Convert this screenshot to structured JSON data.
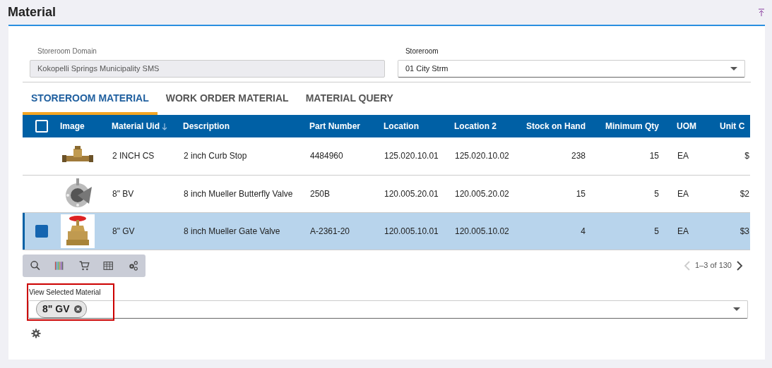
{
  "page_title": "Material",
  "fields": [
    {
      "label": "Storeroom Domain",
      "value": "Kokopelli Springs Municipality SMS",
      "disabled": true,
      "kind": "text"
    },
    {
      "label": "Storeroom",
      "value": "01 City Strm",
      "disabled": false,
      "kind": "select"
    }
  ],
  "tabs": [
    {
      "label": "STOREROOM MATERIAL",
      "selected": true
    },
    {
      "label": "WORK ORDER MATERIAL",
      "selected": false
    },
    {
      "label": "MATERIAL QUERY",
      "selected": false
    }
  ],
  "table": {
    "select_all_checked": false,
    "image_column": "Image",
    "columns": [
      {
        "label": "Material Uid",
        "sorted": true
      },
      {
        "label": "Description",
        "sorted": false
      },
      {
        "label": "Part Number",
        "sorted": false
      },
      {
        "label": "Location",
        "sorted": false
      },
      {
        "label": "Location 2",
        "sorted": false
      },
      {
        "label": "Stock on Hand",
        "sorted": false
      },
      {
        "label": "Minimum Qty",
        "sorted": false
      },
      {
        "label": "UOM",
        "sorted": false
      },
      {
        "label": "Unit C",
        "sorted": false
      }
    ],
    "rows": [
      {
        "selected": false,
        "cells": [
          "2 INCH CS",
          "2 inch Curb Stop",
          "4484960",
          "125.020.10.01",
          "125.020.10.02",
          "238",
          "15",
          "EA",
          "$"
        ]
      },
      {
        "selected": false,
        "cells": [
          "8\" BV",
          "8 inch Mueller Butterfly Valve",
          "250B",
          "120.005.20.01",
          "120.005.20.02",
          "15",
          "5",
          "EA",
          "$2"
        ]
      },
      {
        "selected": true,
        "cells": [
          "8\" GV",
          "8 inch Mueller Gate Valve",
          "A-2361-20",
          "120.005.10.01",
          "120.005.10.02",
          "4",
          "5",
          "EA",
          "$3"
        ]
      }
    ]
  },
  "pager": {
    "text": "1–3 of 130",
    "prev_disabled": true,
    "next_disabled": false
  },
  "selected_material": {
    "label": "View Selected Material",
    "chips": [
      "8\" GV"
    ],
    "highlighted": true
  }
}
